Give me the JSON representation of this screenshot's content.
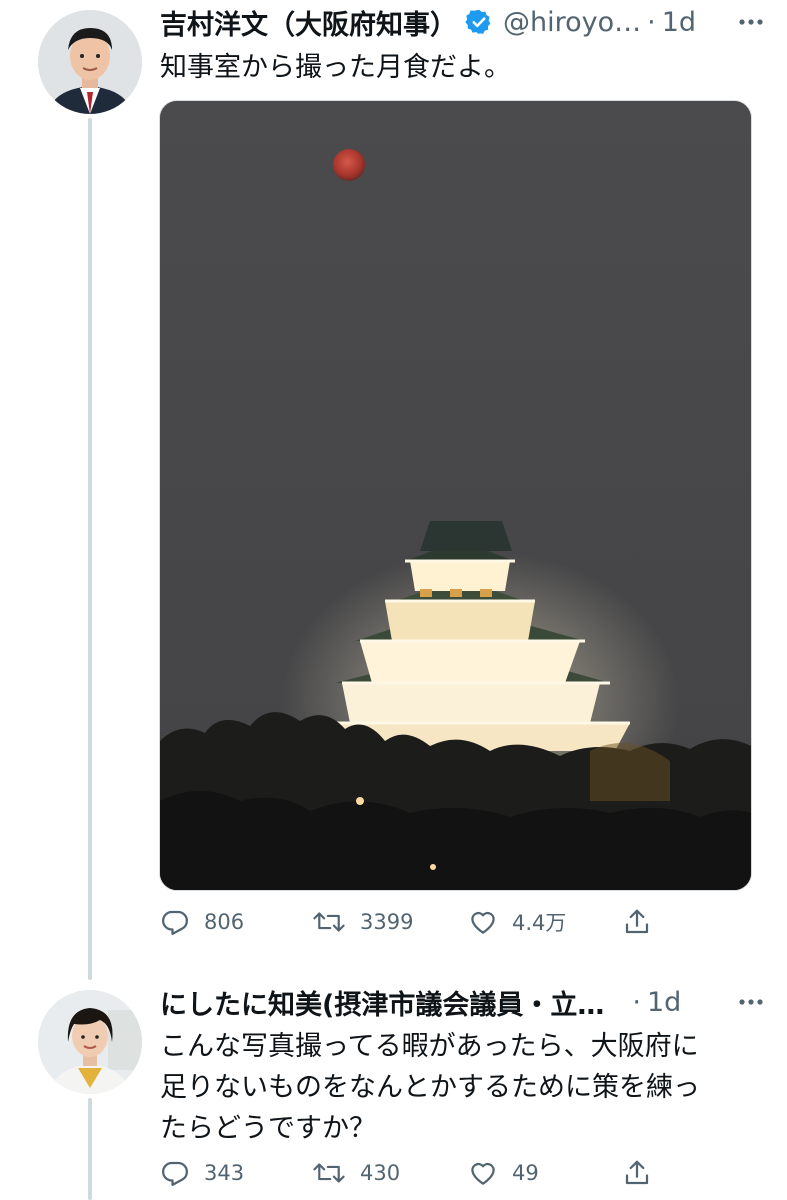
{
  "tweets": [
    {
      "author_name": "吉村洋文（大阪府知事）",
      "handle": "@hiroyo…",
      "separator": "·",
      "time": "1d",
      "text": "知事室から撮った月食だよ。",
      "verified": true,
      "replies": "806",
      "retweets": "3399",
      "likes": "4.4万"
    },
    {
      "author_name": "にしたに知美(摂津市議会議員・立…",
      "separator": "·",
      "time": "1d",
      "text": "こんな写真撮ってる暇があったら、大阪府に\n足りないものをなんとかするために策を練っ\nたらどうですか？",
      "replies": "343",
      "retweets": "430",
      "likes": "49"
    }
  ],
  "colors": {
    "text": "#0f1419",
    "secondary": "#536471",
    "verified": "#1d9bf0",
    "thread_line": "#cfd9de"
  }
}
